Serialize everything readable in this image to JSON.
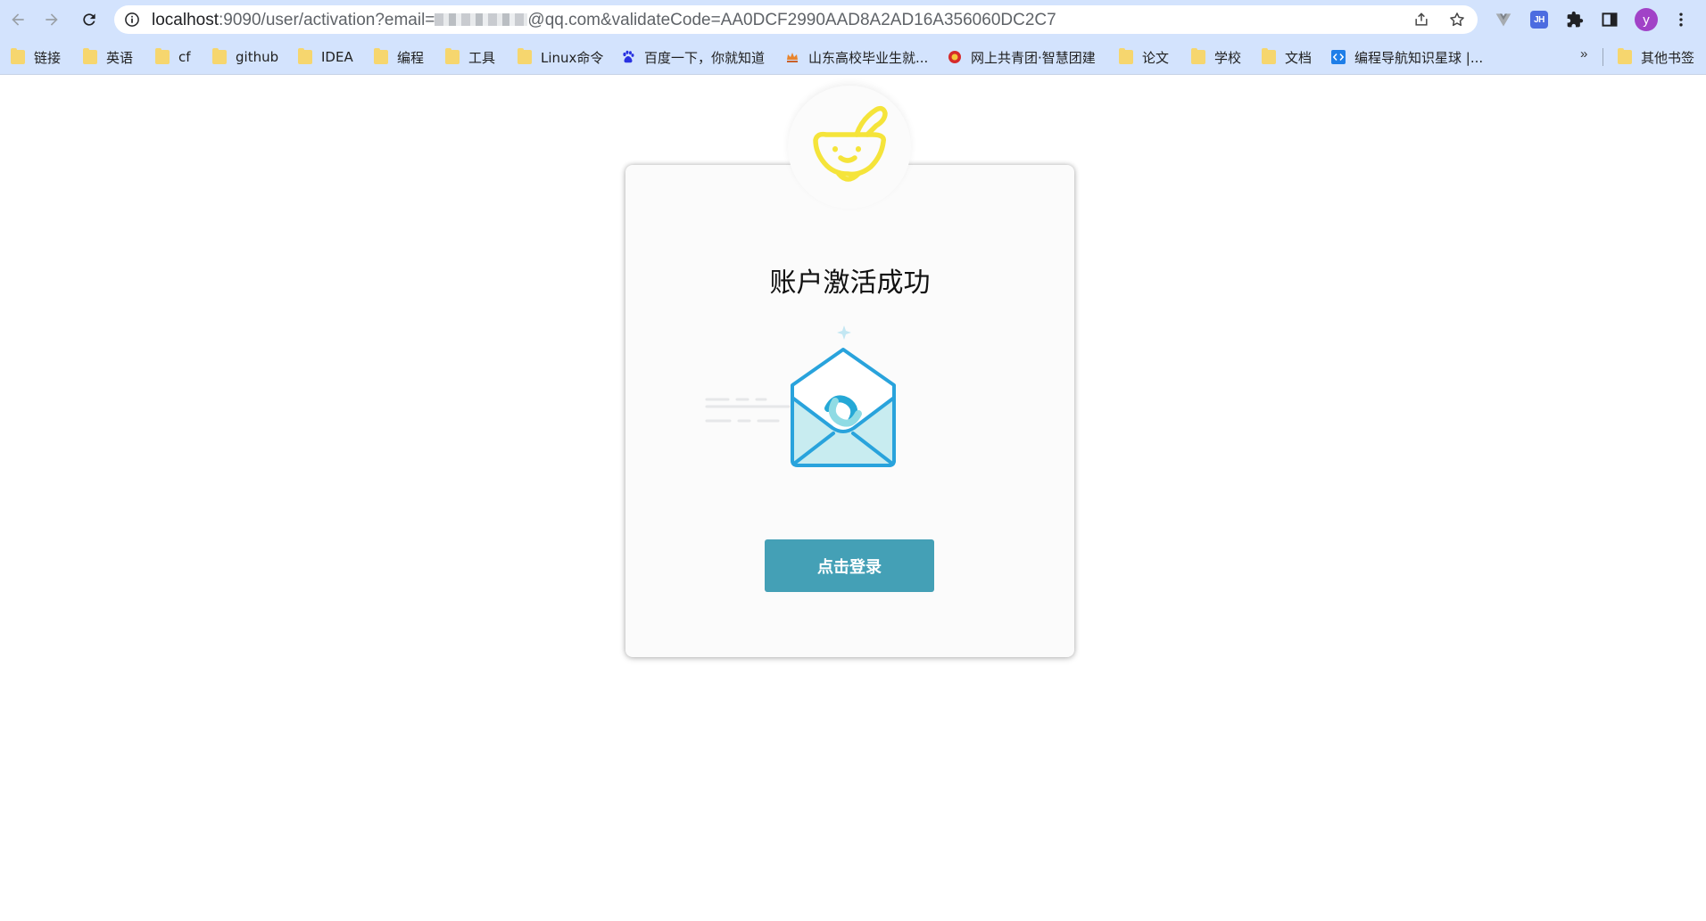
{
  "browser": {
    "url_host": "localhost",
    "url_rest_before_email": ":9090/user/activation?email=",
    "url_rest_after_email": "@qq.com&validateCode=AA0DCF2990AAD8A2AD16A356060DC2C7",
    "profile_initial": "y",
    "extension_jh_label": "JH"
  },
  "bookmarks": {
    "items": [
      {
        "label": "链接",
        "icon": "folder-icon"
      },
      {
        "label": "英语",
        "icon": "folder-icon"
      },
      {
        "label": "cf",
        "icon": "folder-icon"
      },
      {
        "label": "github",
        "icon": "folder-icon"
      },
      {
        "label": "IDEA",
        "icon": "folder-icon"
      },
      {
        "label": "编程",
        "icon": "folder-icon"
      },
      {
        "label": "工具",
        "icon": "folder-icon"
      },
      {
        "label": "Linux命令",
        "icon": "folder-icon"
      },
      {
        "label": "百度一下，你就知道",
        "icon": "baidu-paw-icon"
      },
      {
        "label": "山东高校毕业生就...",
        "icon": "crown-icon"
      },
      {
        "label": "网上共青团·智慧团建",
        "icon": "youth-league-icon"
      },
      {
        "label": "论文",
        "icon": "folder-icon"
      },
      {
        "label": "学校",
        "icon": "folder-icon"
      },
      {
        "label": "文档",
        "icon": "folder-icon"
      },
      {
        "label": "编程导航知识星球 |...",
        "icon": "code-nav-icon"
      }
    ],
    "overflow": "»",
    "other": {
      "label": "其他书签",
      "icon": "folder-icon"
    }
  },
  "page": {
    "title": "账户激活成功",
    "login_button": "点击登录"
  },
  "colors": {
    "toolbar_bg": "#d3e3fd",
    "button_bg": "#44a0b6",
    "envelope_stroke": "#29a3dc",
    "envelope_fill": "#c8ecf0",
    "logo_yellow": "#f5e43a"
  }
}
